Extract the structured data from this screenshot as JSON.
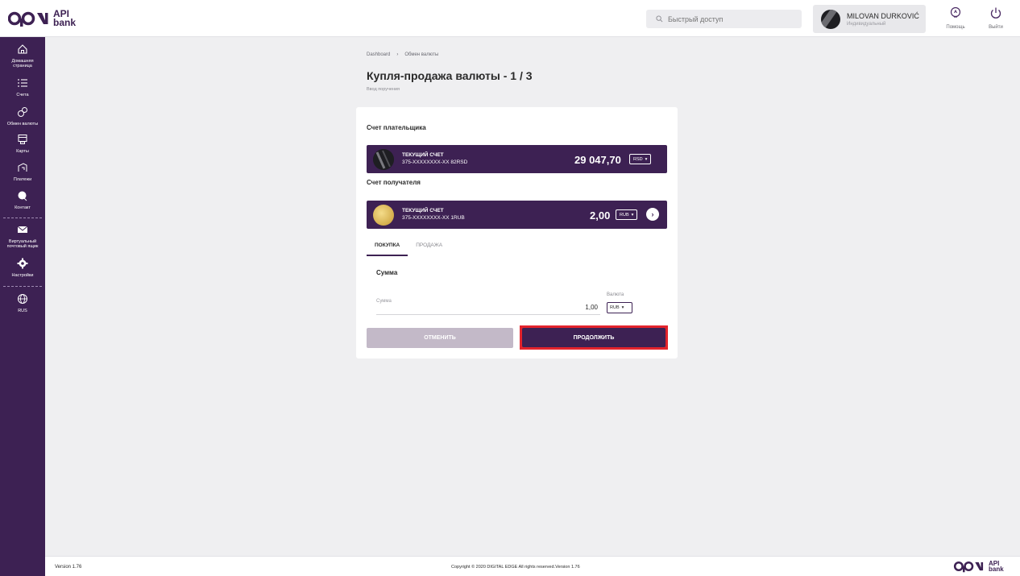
{
  "brand": {
    "logo_text_line1": "API",
    "logo_text_line2": "bank",
    "primary": "#3d2153",
    "highlight": "#e3232c"
  },
  "header": {
    "search_placeholder": "Быстрый доступ",
    "user_name": "MILOVAN DURKOVIĆ",
    "user_role": "Индивидуальный",
    "help_label": "Помощь",
    "logout_label": "Выйти"
  },
  "sidebar": {
    "items": [
      {
        "icon": "home-icon",
        "label_line1": "Домашняя",
        "label_line2": "страница"
      },
      {
        "icon": "list-icon",
        "label_line1": "Счета",
        "label_line2": ""
      },
      {
        "icon": "exchange-icon",
        "label_line1": "Обмен валюты",
        "label_line2": ""
      },
      {
        "icon": "cards-icon",
        "label_line1": "Карты",
        "label_line2": ""
      },
      {
        "icon": "payment-icon",
        "label_line1": "Платежи",
        "label_line2": ""
      },
      {
        "icon": "contact-icon",
        "label_line1": "Контакт",
        "label_line2": ""
      },
      {
        "icon": "mail-icon",
        "label_line1": "Виртуальный",
        "label_line2": "почтовый ящик"
      },
      {
        "icon": "gear-icon",
        "label_line1": "Настройки",
        "label_line2": ""
      },
      {
        "icon": "globe-icon",
        "label_line1": "RUS",
        "label_line2": ""
      }
    ]
  },
  "breadcrumb": {
    "root": "Dashboard",
    "separator": "›",
    "current": "Обмен валюты"
  },
  "page": {
    "title": "Купля-продажа валюты - 1 / 3",
    "subtitle": "Ввод поручения"
  },
  "form": {
    "payer_label": "Счет плательщика",
    "payer_account": {
      "type": "ТЕКУЩИЙ СЧЕТ",
      "number": "375-XXXXXXXX-XX 82RSD",
      "amount": "29 047,70",
      "currency": "RSD"
    },
    "receiver_label": "Счет получателя",
    "receiver_account": {
      "type": "ТЕКУЩИЙ СЧЕТ",
      "number": "375-XXXXXXXX-XX 1RUB",
      "amount": "2,00",
      "currency": "RUB"
    },
    "tabs": [
      "ПОКУПКА",
      "ПРОДАЖА"
    ],
    "amount_section": "Сумма",
    "amount_placeholder": "Сумма",
    "amount_value": "1,00",
    "currency_label": "Валюта",
    "currency_value": "RUB",
    "cancel_label": "ОТМЕНИТЬ",
    "continue_label": "ПРОДОЛЖИТЬ"
  },
  "footer": {
    "version": "Version 1.76",
    "copyright": "Copyright © 2020 DIGITAL EDGE All rights reserved.Version 1.76"
  }
}
